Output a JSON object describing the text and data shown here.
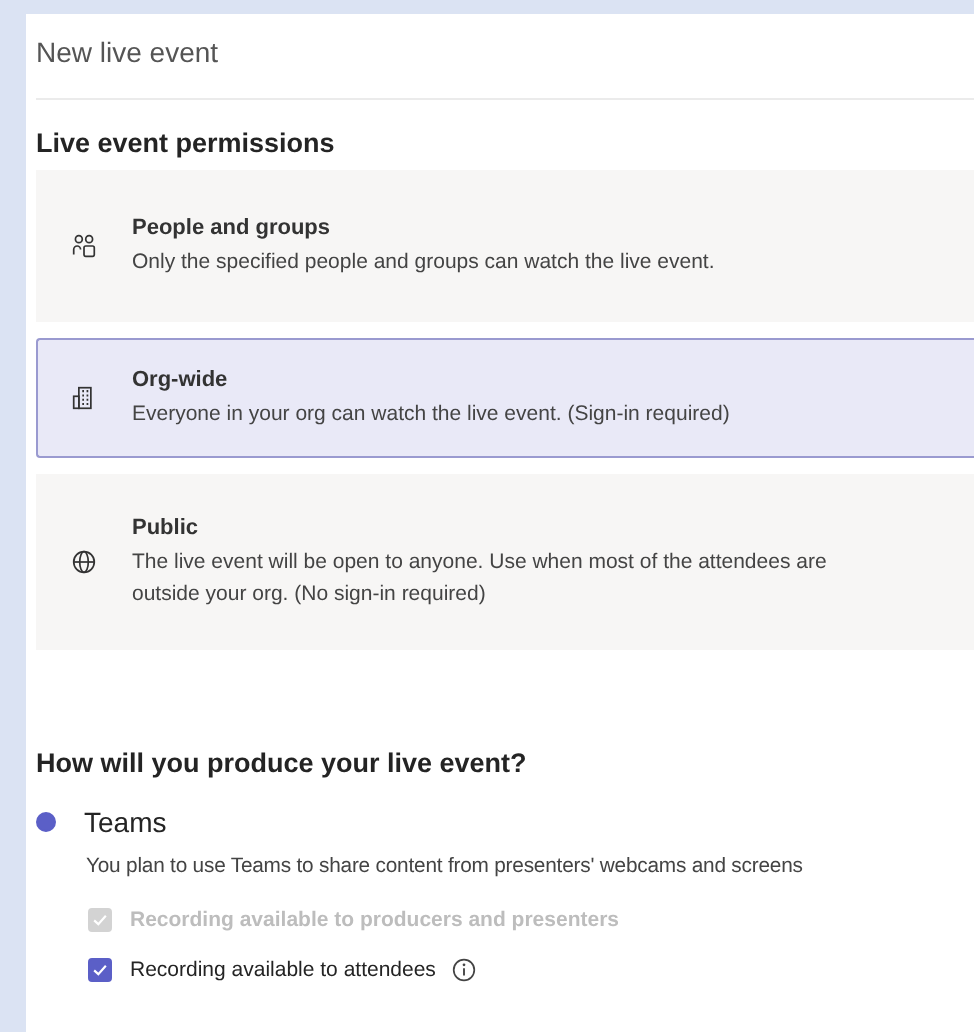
{
  "title": "New live event",
  "permissions": {
    "heading": "Live event permissions",
    "options": [
      {
        "kind": "people",
        "title": "People and groups",
        "description": "Only the specified people and groups can watch the live event.",
        "selected": false
      },
      {
        "kind": "org",
        "title": "Org-wide",
        "description": "Everyone in your org can watch the live event. (Sign-in required)",
        "selected": true
      },
      {
        "kind": "public",
        "title": "Public",
        "description": "The live event will be open to anyone. Use when most of the attendees are outside your org. (No sign-in required)",
        "selected": false
      }
    ]
  },
  "production": {
    "heading": "How will you produce your live event?",
    "options": [
      {
        "label": "Teams",
        "selected": true,
        "description": "You plan to use Teams to share content from presenters' webcams and screens",
        "checkboxes": [
          {
            "label": "Recording available to producers and presenters",
            "checked": true,
            "disabled": true,
            "info": false
          },
          {
            "label": "Recording available to attendees",
            "checked": true,
            "disabled": false,
            "info": true
          }
        ]
      }
    ]
  }
}
